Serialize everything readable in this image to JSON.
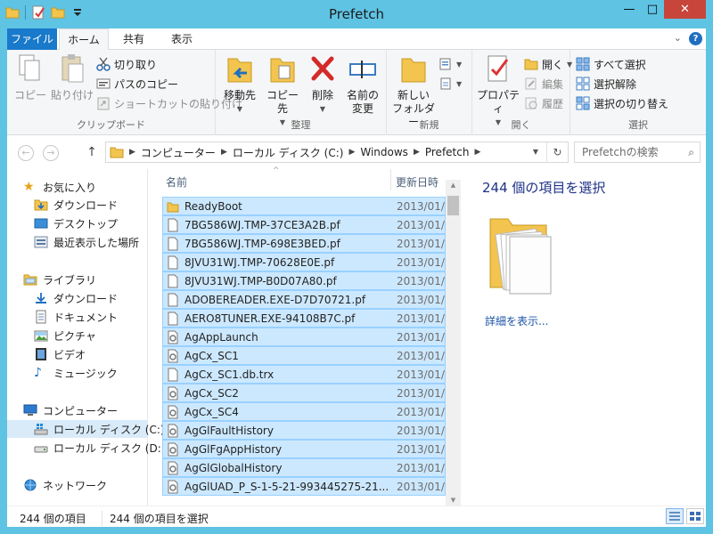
{
  "window": {
    "title": "Prefetch",
    "minimize": "—",
    "maximize": "□",
    "close": "✕"
  },
  "tabs": {
    "file": "ファイル",
    "home": "ホーム",
    "share": "共有",
    "view": "表示",
    "expand": "⌄",
    "help": "?"
  },
  "ribbon": {
    "clipboard": {
      "label": "クリップボード",
      "copy": "コピー",
      "paste": "貼り付け",
      "cut": "切り取り",
      "copy_path": "パスのコピー",
      "paste_shortcut": "ショートカットの貼り付け"
    },
    "organize": {
      "label": "整理",
      "move_to": "移動先",
      "copy_to": "コピー先",
      "delete": "削除",
      "rename_line1": "名前の",
      "rename_line2": "変更"
    },
    "new": {
      "label": "新規",
      "new_folder_line1": "新しい",
      "new_folder_line2": "フォルダー"
    },
    "open": {
      "label": "開く",
      "properties": "プロパティ",
      "open": "開く",
      "edit": "編集",
      "history": "履歴"
    },
    "select": {
      "label": "選択",
      "select_all": "すべて選択",
      "select_none": "選択解除",
      "invert": "選択の切り替え"
    }
  },
  "address": {
    "nav_back": "←",
    "nav_forward": "→",
    "nav_up": "↑",
    "crumbs": [
      "コンピューター",
      "ローカル ディスク (C:)",
      "Windows",
      "Prefetch"
    ],
    "refresh": "↻",
    "search_placeholder": "Prefetchの検索"
  },
  "sidebar": {
    "favorites": {
      "label": "お気に入り",
      "items": [
        "ダウンロード",
        "デスクトップ",
        "最近表示した場所"
      ]
    },
    "libraries": {
      "label": "ライブラリ",
      "items": [
        "ダウンロード",
        "ドキュメント",
        "ピクチャ",
        "ビデオ",
        "ミュージック"
      ]
    },
    "computer": {
      "label": "コンピューター",
      "items": [
        "ローカル ディスク (C:)",
        "ローカル ディスク (D:)"
      ]
    },
    "network": {
      "label": "ネットワーク"
    }
  },
  "filelist": {
    "col_name": "名前",
    "col_date": "更新日時",
    "sort_caret": "^",
    "rows": [
      {
        "name": "ReadyBoot",
        "date": "2013/01/",
        "kind": "folder"
      },
      {
        "name": "7BG586WJ.TMP-37CE3A2B.pf",
        "date": "2013/01/",
        "kind": "file"
      },
      {
        "name": "7BG586WJ.TMP-698E3BED.pf",
        "date": "2013/01/",
        "kind": "file"
      },
      {
        "name": "8JVU31WJ.TMP-70628E0E.pf",
        "date": "2013/01/",
        "kind": "file"
      },
      {
        "name": "8JVU31WJ.TMP-B0D07A80.pf",
        "date": "2013/01/",
        "kind": "file"
      },
      {
        "name": "ADOBEREADER.EXE-D7D70721.pf",
        "date": "2013/01/",
        "kind": "file"
      },
      {
        "name": "AERO8TUNER.EXE-94108B7C.pf",
        "date": "2013/01/",
        "kind": "file"
      },
      {
        "name": "AgAppLaunch",
        "date": "2013/01/",
        "kind": "sys"
      },
      {
        "name": "AgCx_SC1",
        "date": "2013/01/",
        "kind": "sys"
      },
      {
        "name": "AgCx_SC1.db.trx",
        "date": "2013/01/",
        "kind": "file"
      },
      {
        "name": "AgCx_SC2",
        "date": "2013/01/",
        "kind": "sys"
      },
      {
        "name": "AgCx_SC4",
        "date": "2013/01/",
        "kind": "sys"
      },
      {
        "name": "AgGlFaultHistory",
        "date": "2013/01/",
        "kind": "sys"
      },
      {
        "name": "AgGlFgAppHistory",
        "date": "2013/01/",
        "kind": "sys"
      },
      {
        "name": "AgGlGlobalHistory",
        "date": "2013/01/",
        "kind": "sys"
      },
      {
        "name": "AgGlUAD_P_S-1-5-21-993445275-21...",
        "date": "2013/01/",
        "kind": "sys"
      }
    ]
  },
  "preview": {
    "title": "244 個の項目を選択",
    "details_link": "詳細を表示..."
  },
  "status": {
    "count": "244 個の項目",
    "selected": "244 個の項目を選択"
  }
}
